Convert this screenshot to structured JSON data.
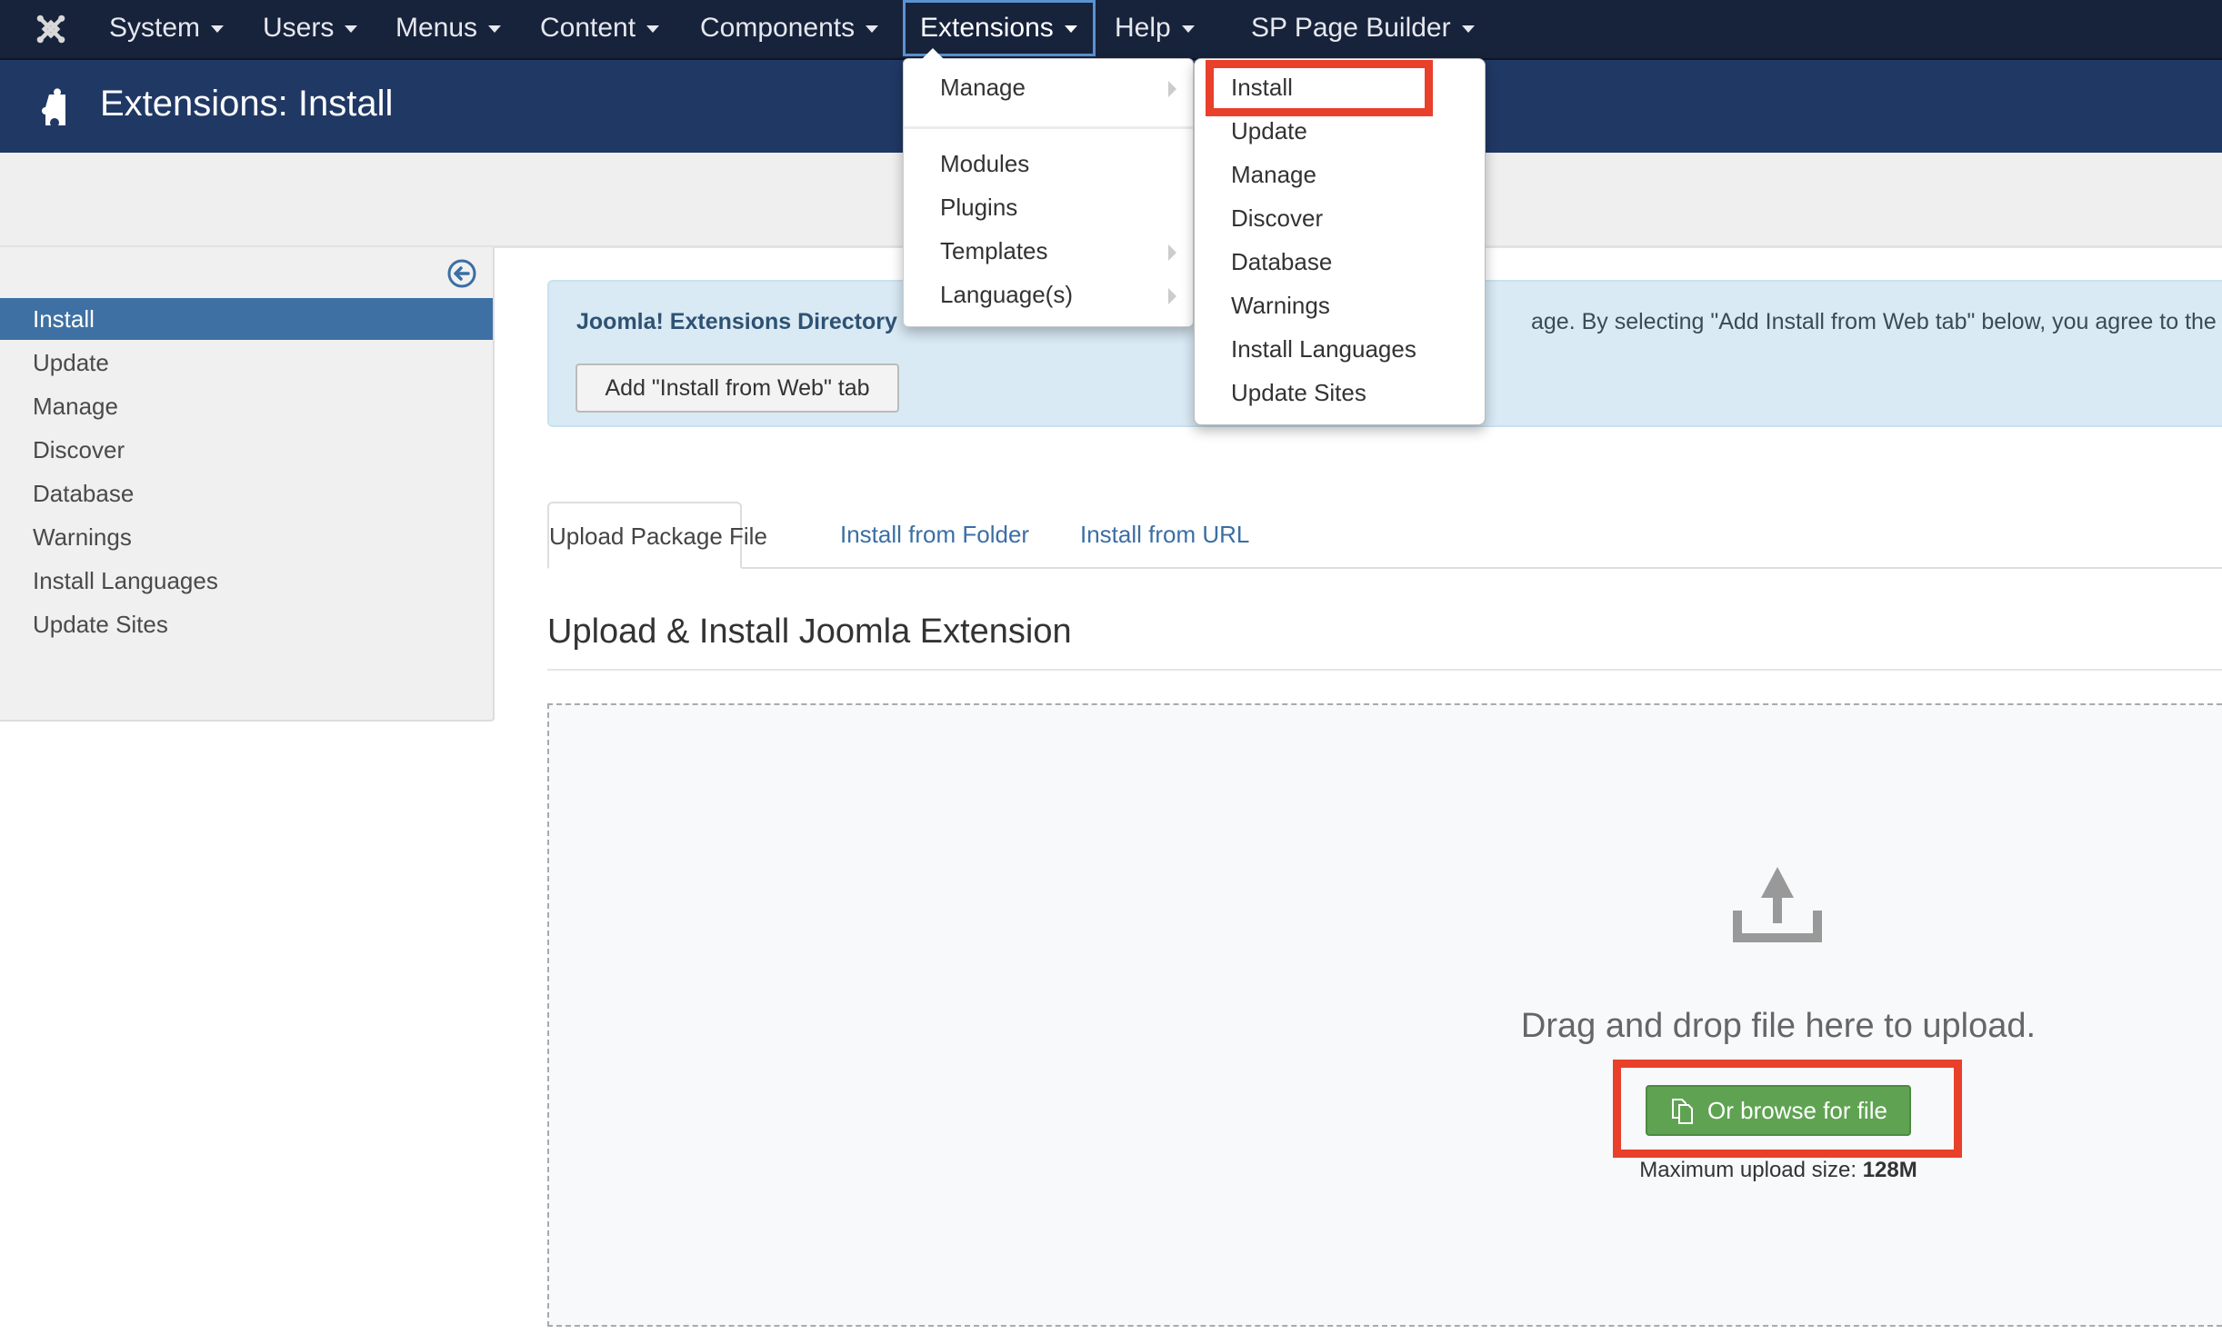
{
  "navbar": {
    "logo_icon": "joomla-logo-icon",
    "items": [
      {
        "label": "System",
        "has_caret": true
      },
      {
        "label": "Users",
        "has_caret": true
      },
      {
        "label": "Menus",
        "has_caret": true
      },
      {
        "label": "Content",
        "has_caret": true
      },
      {
        "label": "Components",
        "has_caret": true
      },
      {
        "label": "Extensions",
        "has_caret": true,
        "active": true
      },
      {
        "label": "Help",
        "has_caret": true
      },
      {
        "label": "SP Page Builder",
        "has_caret": true
      }
    ]
  },
  "header": {
    "icon": "puzzle-piece-icon",
    "title": "Extensions: Install"
  },
  "extensions_menu": {
    "items": [
      {
        "label": "Manage",
        "has_submenu": true
      },
      {
        "label": "Modules",
        "has_submenu": false
      },
      {
        "label": "Plugins",
        "has_submenu": false
      },
      {
        "label": "Templates",
        "has_submenu": true
      },
      {
        "label": "Language(s)",
        "has_submenu": true
      }
    ]
  },
  "manage_submenu": {
    "items": [
      {
        "label": "Install",
        "highlighted": true
      },
      {
        "label": "Update"
      },
      {
        "label": "Manage"
      },
      {
        "label": "Discover"
      },
      {
        "label": "Database"
      },
      {
        "label": "Warnings"
      },
      {
        "label": "Install Languages"
      },
      {
        "label": "Update Sites"
      }
    ]
  },
  "sidebar": {
    "toggle_icon": "arrow-left-circle-icon",
    "items": [
      {
        "label": "Install",
        "active": true
      },
      {
        "label": "Update"
      },
      {
        "label": "Manage"
      },
      {
        "label": "Discover"
      },
      {
        "label": "Database"
      },
      {
        "label": "Warnings"
      },
      {
        "label": "Install Languages"
      },
      {
        "label": "Update Sites"
      }
    ]
  },
  "info_banner": {
    "strong_text": "Joomla! Extensions Directory",
    "rest_text": "age. By selecting \"Add Install from Web tab\" below, you agree to the J",
    "button_label": "Add \"Install from Web\" tab"
  },
  "tabs": [
    {
      "label": "Upload Package File",
      "active": true
    },
    {
      "label": "Install from Folder"
    },
    {
      "label": "Install from URL"
    }
  ],
  "upload": {
    "section_title": "Upload & Install Joomla Extension",
    "upload_icon": "upload-icon",
    "drop_text": "Drag and drop file here to upload.",
    "browse_label": "Or browse for file",
    "browse_icon": "files-icon",
    "max_label": "Maximum upload size:",
    "max_value": "128M"
  },
  "colors": {
    "navbar_bg": "#17223b",
    "header_bg": "#203864",
    "sidebar_active": "#3e70a3",
    "highlight": "#e8402a",
    "success_button": "#5fa352",
    "link": "#3b6ea5"
  }
}
